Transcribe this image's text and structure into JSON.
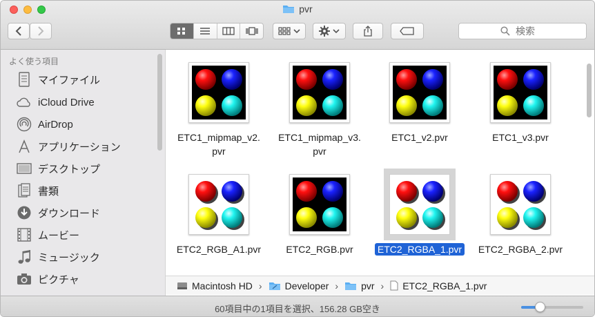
{
  "window": {
    "title": "pvr"
  },
  "toolbar": {
    "search_placeholder": "検索",
    "view_mode": "icon"
  },
  "sidebar": {
    "section_title": "よく使う項目",
    "items": [
      {
        "label": "マイファイル",
        "icon": "all-files-icon"
      },
      {
        "label": "iCloud Drive",
        "icon": "cloud-icon"
      },
      {
        "label": "AirDrop",
        "icon": "airdrop-icon"
      },
      {
        "label": "アプリケーション",
        "icon": "applications-icon"
      },
      {
        "label": "デスクトップ",
        "icon": "desktop-icon"
      },
      {
        "label": "書類",
        "icon": "documents-icon"
      },
      {
        "label": "ダウンロード",
        "icon": "download-icon"
      },
      {
        "label": "ムービー",
        "icon": "movies-icon"
      },
      {
        "label": "ミュージック",
        "icon": "music-icon"
      },
      {
        "label": "ピクチャ",
        "icon": "camera-icon"
      }
    ]
  },
  "files": [
    {
      "name_line1": "ETC1_mipmap_v2.",
      "name_line2": "pvr",
      "style": "dark",
      "selected": false
    },
    {
      "name_line1": "ETC1_mipmap_v3.",
      "name_line2": "pvr",
      "style": "dark",
      "selected": false
    },
    {
      "name_line1": "ETC1_v2.pvr",
      "name_line2": "",
      "style": "dark",
      "selected": false
    },
    {
      "name_line1": "ETC1_v3.pvr",
      "name_line2": "",
      "style": "dark",
      "selected": false
    },
    {
      "name_line1": "ETC2_RGB_A1.pvr",
      "name_line2": "",
      "style": "light",
      "selected": false
    },
    {
      "name_line1": "ETC2_RGB.pvr",
      "name_line2": "",
      "style": "dark",
      "selected": false
    },
    {
      "name_line1": "ETC2_RGBA_1.pvr",
      "name_line2": "",
      "style": "light",
      "selected": true
    },
    {
      "name_line1": "ETC2_RGBA_2.pvr",
      "name_line2": "",
      "style": "light",
      "selected": false
    }
  ],
  "pathbar": [
    "Macintosh HD",
    "Developer",
    "pvr",
    "ETC2_RGBA_1.pvr"
  ],
  "status": {
    "text": "60項目中の1項目を選択、156.28 GB空き",
    "zoom_level": 0.3
  },
  "colors": {
    "selection": "#1f63d6",
    "folder": "#5aaef2"
  }
}
